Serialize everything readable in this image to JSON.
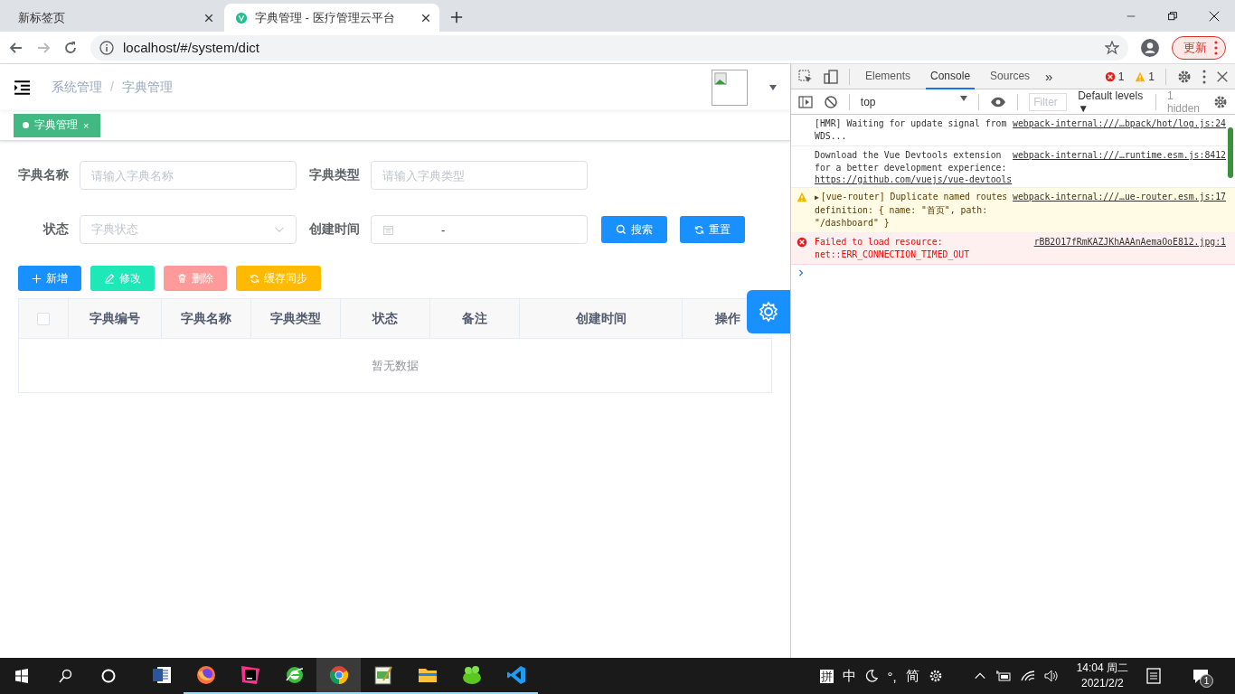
{
  "browser": {
    "tabs": [
      {
        "title": "新标签页",
        "selected": false
      },
      {
        "title": "字典管理 - 医疗管理云平台",
        "selected": true
      }
    ],
    "url": "localhost/#/system/dict",
    "update_button": "更新"
  },
  "navbar": {
    "breadcrumb": [
      "系统管理",
      "字典管理"
    ],
    "separator": "/"
  },
  "tags_view": [
    {
      "label": "字典管理",
      "selected": true,
      "close": "×"
    }
  ],
  "search_form": {
    "fields": [
      {
        "label": "字典名称",
        "kind": "input",
        "placeholder": "请输入字典名称"
      },
      {
        "label": "字典类型",
        "kind": "input",
        "placeholder": "请输入字典类型"
      },
      {
        "label": "状态",
        "kind": "select",
        "placeholder": "字典状态"
      },
      {
        "label": "创建时间",
        "kind": "daterange",
        "separator": "-"
      }
    ],
    "buttons": [
      {
        "label": "搜索",
        "kind": "search"
      },
      {
        "label": "重置",
        "kind": "reset"
      }
    ]
  },
  "toolbar": [
    {
      "label": "新增",
      "kind": "add",
      "disabled": false
    },
    {
      "label": "修改",
      "kind": "edit",
      "disabled": true
    },
    {
      "label": "删除",
      "kind": "delete",
      "disabled": true
    },
    {
      "label": "缓存同步",
      "kind": "sync",
      "disabled": false
    }
  ],
  "table": {
    "select_all": {
      "checked": false
    },
    "columns": [
      "字典编号",
      "字典名称",
      "字典类型",
      "状态",
      "备注",
      "创建时间",
      "操作"
    ],
    "empty_text": "暂无数据"
  },
  "devtools": {
    "tabs": [
      {
        "label": "Elements",
        "selected": false
      },
      {
        "label": "Console",
        "selected": true
      },
      {
        "label": "Sources",
        "selected": false
      }
    ],
    "more": "»",
    "errors": "1",
    "warnings": "1",
    "context": "top",
    "filter_placeholder": "Filter",
    "levels": "Default levels ▼",
    "hidden": "1 hidden",
    "messages": [
      {
        "kind": "log",
        "text": "[HMR] Waiting for update signal from WDS...",
        "source": "webpack-internal:///…bpack/hot/log.js:24"
      },
      {
        "kind": "log",
        "text": "Download the Vue Devtools extension for a better development experience:",
        "link": "https://github.com/vuejs/vue-devtools",
        "source": "webpack-internal:///…runtime.esm.js:8412"
      },
      {
        "kind": "warning",
        "marker": "▶",
        "text": "[vue-router] Duplicate named routes definition: { name: \"首页\", path: \"/dashboard\" }",
        "source": "webpack-internal:///…ue-router.esm.js:17"
      },
      {
        "kind": "error",
        "text": "Failed to load resource: net::ERR_CONNECTION_TIMED_OUT",
        "source": "rBB2O17fRmKAZJKhAAAnAemaOoE812.jpg:1"
      }
    ]
  },
  "taskbar": {
    "apps": [
      {
        "kind": "word",
        "running": false,
        "selected": false
      },
      {
        "kind": "firefox",
        "running": true,
        "selected": false
      },
      {
        "kind": "intellij",
        "running": true,
        "selected": false
      },
      {
        "kind": "ie",
        "running": true,
        "selected": false
      },
      {
        "kind": "chrome",
        "running": true,
        "selected": true
      },
      {
        "kind": "notepad",
        "running": true,
        "selected": false
      },
      {
        "kind": "explorer",
        "running": true,
        "selected": false
      },
      {
        "kind": "frog",
        "running": true,
        "selected": false
      },
      {
        "kind": "vscode",
        "running": true,
        "selected": false
      }
    ],
    "ime": [
      "拼",
      "中",
      "°,",
      "简"
    ],
    "time": "14:04 周二",
    "date": "2021/2/2",
    "notifications": "1"
  }
}
